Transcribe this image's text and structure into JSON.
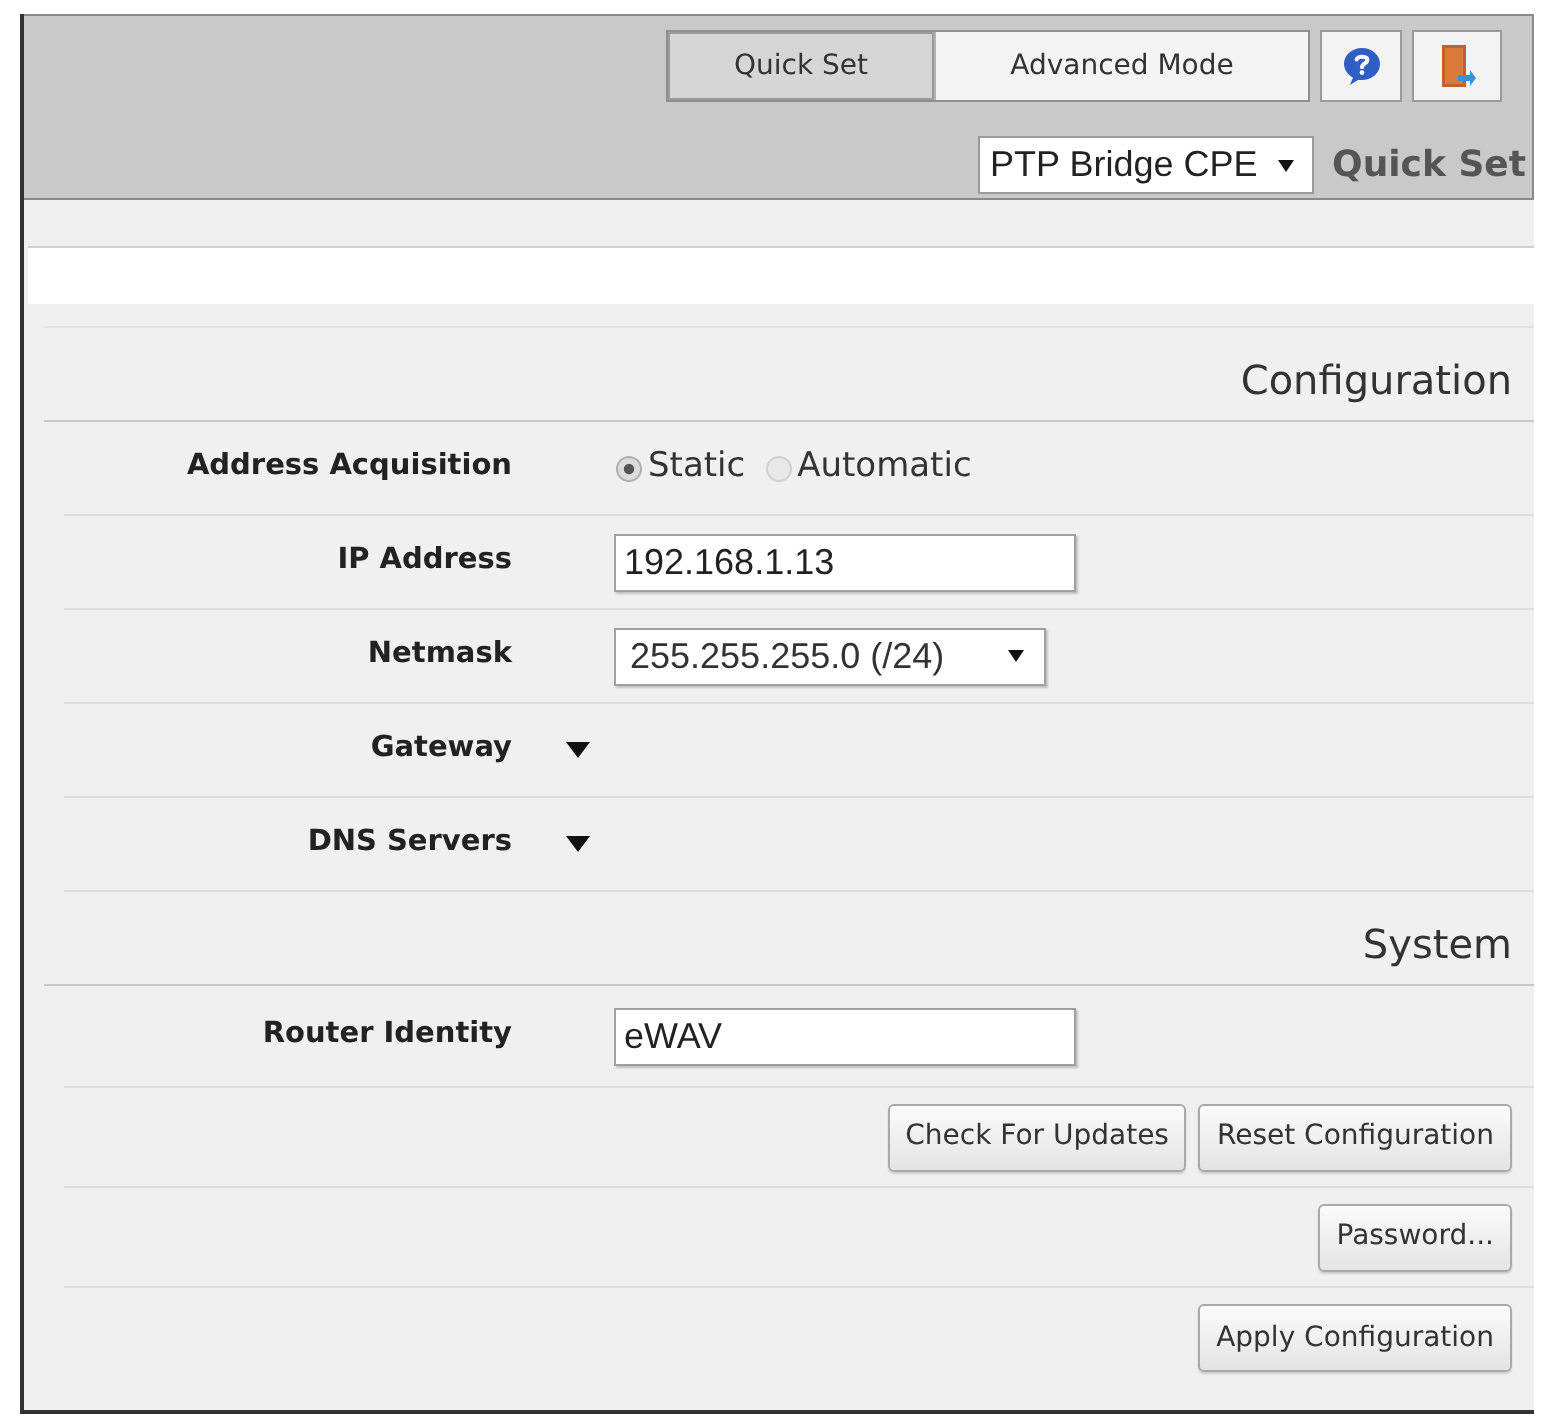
{
  "header": {
    "tabs": [
      {
        "label": "Quick Set",
        "selected": true
      },
      {
        "label": "Advanced Mode",
        "selected": false
      }
    ],
    "mode_select": {
      "value": "PTP Bridge CPE"
    },
    "title": "Quick Set"
  },
  "sections": [
    {
      "heading": "Configuration",
      "rows": [
        {
          "kind": "radio",
          "label": "Address Acquisition",
          "options": [
            {
              "label": "Static",
              "selected": true
            },
            {
              "label": "Automatic",
              "selected": false
            }
          ]
        },
        {
          "kind": "input",
          "label": "IP Address",
          "value": "192.168.1.13"
        },
        {
          "kind": "select",
          "label": "Netmask",
          "value": "255.255.255.0 (/24)"
        },
        {
          "kind": "expander",
          "label": "Gateway",
          "expanded": false
        },
        {
          "kind": "expander",
          "label": "DNS Servers",
          "expanded": false
        }
      ]
    },
    {
      "heading": "System",
      "rows": [
        {
          "kind": "input",
          "label": "Router Identity",
          "value": "eWAV"
        },
        {
          "kind": "buttons",
          "buttons": [
            "Check For Updates",
            "Reset Configuration"
          ]
        },
        {
          "kind": "buttons",
          "buttons": [
            "Password..."
          ]
        },
        {
          "kind": "buttons",
          "buttons": [
            "Apply Configuration"
          ]
        }
      ]
    }
  ]
}
